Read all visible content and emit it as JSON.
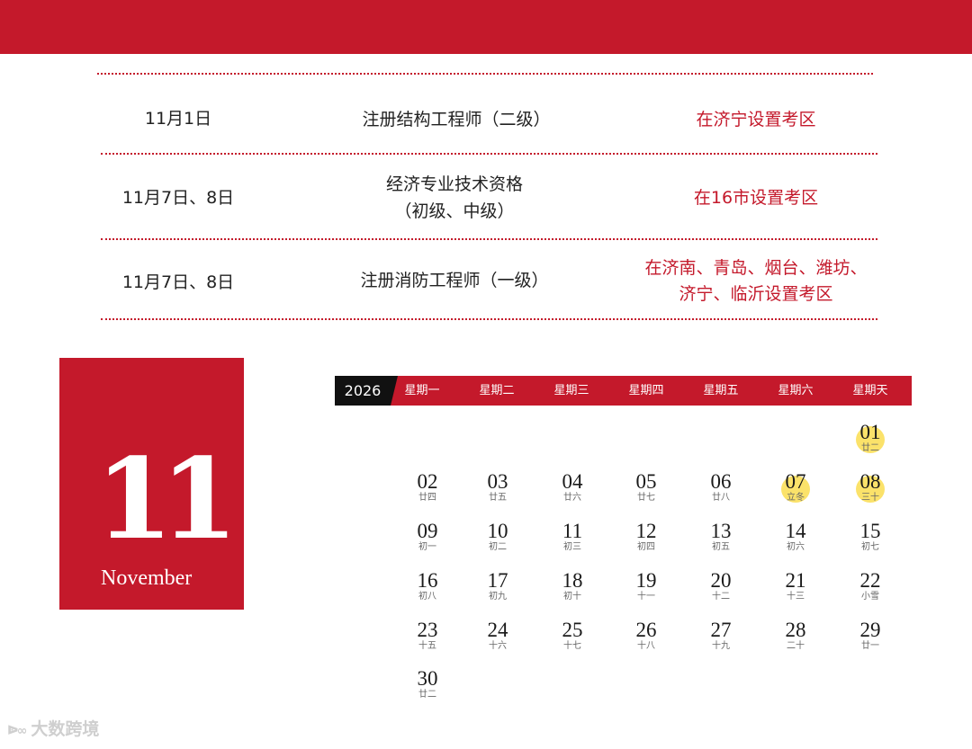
{
  "colors": {
    "primary_red": "#c4192b",
    "highlight_yellow": "#fbe26a",
    "header_black": "#111111"
  },
  "exam_schedule": [
    {
      "date": "11月1日",
      "exam": [
        "注册结构工程师（二级）"
      ],
      "location": [
        "在济宁设置考区"
      ]
    },
    {
      "date": "11月7日、8日",
      "exam": [
        "经济专业技术资格",
        "（初级、中级）"
      ],
      "location": [
        "在16市设置考区"
      ]
    },
    {
      "date": "11月7日、8日",
      "exam": [
        "注册消防工程师（一级）"
      ],
      "location": [
        "在济南、青岛、烟台、潍坊、",
        "济宁、临沂设置考区"
      ]
    }
  ],
  "month": {
    "number": "11",
    "name": "November"
  },
  "calendar": {
    "year": "2026",
    "weekdays": [
      "星期一",
      "星期二",
      "星期三",
      "星期四",
      "星期五",
      "星期六",
      "星期天"
    ],
    "days": [
      {
        "day": "01",
        "lunar": "廿二",
        "highlight": true
      },
      {
        "day": "02",
        "lunar": "廿四"
      },
      {
        "day": "03",
        "lunar": "廿五"
      },
      {
        "day": "04",
        "lunar": "廿六"
      },
      {
        "day": "05",
        "lunar": "廿七"
      },
      {
        "day": "06",
        "lunar": "廿八"
      },
      {
        "day": "07",
        "lunar": "立冬",
        "highlight": true
      },
      {
        "day": "08",
        "lunar": "三十",
        "highlight": true
      },
      {
        "day": "09",
        "lunar": "初一"
      },
      {
        "day": "10",
        "lunar": "初二"
      },
      {
        "day": "11",
        "lunar": "初三"
      },
      {
        "day": "12",
        "lunar": "初四"
      },
      {
        "day": "13",
        "lunar": "初五"
      },
      {
        "day": "14",
        "lunar": "初六"
      },
      {
        "day": "15",
        "lunar": "初七"
      },
      {
        "day": "16",
        "lunar": "初八"
      },
      {
        "day": "17",
        "lunar": "初九"
      },
      {
        "day": "18",
        "lunar": "初十"
      },
      {
        "day": "19",
        "lunar": "十一"
      },
      {
        "day": "20",
        "lunar": "十二"
      },
      {
        "day": "21",
        "lunar": "十三"
      },
      {
        "day": "22",
        "lunar": "小雪"
      },
      {
        "day": "23",
        "lunar": "十五"
      },
      {
        "day": "24",
        "lunar": "十六"
      },
      {
        "day": "25",
        "lunar": "十七"
      },
      {
        "day": "26",
        "lunar": "十八"
      },
      {
        "day": "27",
        "lunar": "十九"
      },
      {
        "day": "28",
        "lunar": "二十"
      },
      {
        "day": "29",
        "lunar": "廿一"
      },
      {
        "day": "30",
        "lunar": "廿二"
      }
    ]
  },
  "watermark": {
    "logo": "ᐉ∞",
    "text": "大数跨境"
  }
}
